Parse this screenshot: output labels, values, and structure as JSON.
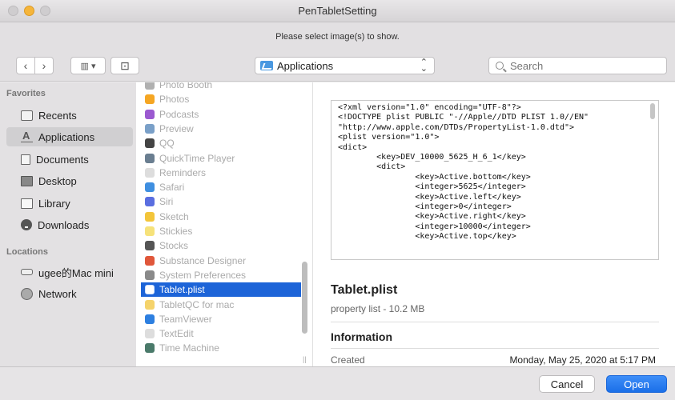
{
  "window": {
    "title": "PenTabletSetting"
  },
  "message": "Please select image(s) to show.",
  "toolbar": {
    "back": "‹",
    "forward": "›",
    "view": "▥ ▾",
    "new_folder": "⊡",
    "location": "Applications",
    "search_placeholder": "Search"
  },
  "sidebar": {
    "favorites_label": "Favorites",
    "favorites": [
      {
        "label": "Recents",
        "icon": "recents-icon"
      },
      {
        "label": "Applications",
        "icon": "applications-icon"
      },
      {
        "label": "Documents",
        "icon": "documents-icon"
      },
      {
        "label": "Desktop",
        "icon": "desktop-icon"
      },
      {
        "label": "Library",
        "icon": "library-icon"
      },
      {
        "label": "Downloads",
        "icon": "downloads-icon"
      }
    ],
    "locations_label": "Locations",
    "locations": [
      {
        "label": "ugee的Mac mini",
        "icon": "disk-icon"
      },
      {
        "label": "Network",
        "icon": "network-icon"
      }
    ]
  },
  "files": [
    {
      "name": "Photo Booth",
      "color": "#b0b0b0"
    },
    {
      "name": "Photos",
      "color": "#f5a623"
    },
    {
      "name": "Podcasts",
      "color": "#9b59d0"
    },
    {
      "name": "Preview",
      "color": "#7aa0c8"
    },
    {
      "name": "QQ",
      "color": "#444444"
    },
    {
      "name": "QuickTime Player",
      "color": "#6a7e90"
    },
    {
      "name": "Reminders",
      "color": "#dddddd"
    },
    {
      "name": "Safari",
      "color": "#3f8fe0"
    },
    {
      "name": "Siri",
      "color": "#5a6ee0"
    },
    {
      "name": "Sketch",
      "color": "#f3c53a"
    },
    {
      "name": "Stickies",
      "color": "#f6e27a"
    },
    {
      "name": "Stocks",
      "color": "#555555"
    },
    {
      "name": "Substance Designer",
      "color": "#e0573a"
    },
    {
      "name": "System Preferences",
      "color": "#8a8a8a"
    },
    {
      "name": "Tablet.plist",
      "color": "#ffffff"
    },
    {
      "name": "TabletQC for mac",
      "color": "#f5d36b"
    },
    {
      "name": "TeamViewer",
      "color": "#2d7fe0"
    },
    {
      "name": "TextEdit",
      "color": "#dddddd"
    },
    {
      "name": "Time Machine",
      "color": "#4a7a6a"
    }
  ],
  "selected_file_index": 14,
  "preview": {
    "code_lines": [
      "<?xml version=\"1.0\" encoding=\"UTF-8\"?>",
      "<!DOCTYPE plist PUBLIC \"-//Apple//DTD PLIST 1.0//EN\"",
      "\"http://www.apple.com/DTDs/PropertyList-1.0.dtd\">",
      "<plist version=\"1.0\">",
      "<dict>",
      "        <key>DEV_10000_5625_H_6_1</key>",
      "        <dict>",
      "                <key>Active.bottom</key>",
      "                <integer>5625</integer>",
      "                <key>Active.left</key>",
      "                <integer>0</integer>",
      "                <key>Active.right</key>",
      "                <integer>10000</integer>",
      "                <key>Active.top</key>"
    ],
    "name": "Tablet.plist",
    "kind": "property list - 10.2 MB",
    "info_heading": "Information",
    "created_label": "Created",
    "created_value": "Monday, May 25, 2020 at 5:17 PM"
  },
  "buttons": {
    "cancel": "Cancel",
    "open": "Open"
  }
}
